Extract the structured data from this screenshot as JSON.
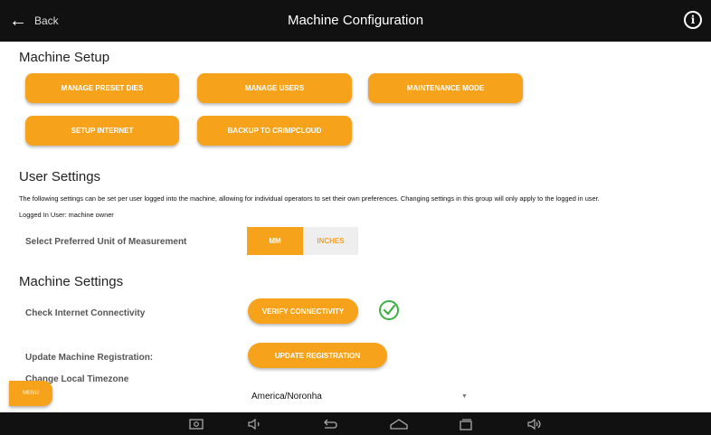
{
  "header": {
    "back_label": "Back",
    "title": "Machine Configuration"
  },
  "machine_setup": {
    "title": "Machine Setup",
    "buttons": [
      "MANAGE PRESET DIES",
      "MANAGE USERS",
      "MAINTENANCE MODE",
      "SETUP INTERNET",
      "BACKUP TO CRIMPCLOUD"
    ]
  },
  "user_settings": {
    "title": "User Settings",
    "description": "The following settings can be set per user logged into the machine, allowing for individual operators to set their own preferences. Changing settings in this group will only apply to the logged in user.",
    "logged_in": "Logged In User: machine owner",
    "unit_label": "Select Preferred Unit of Measurement",
    "unit_options": [
      "MM",
      "INCHES"
    ],
    "unit_selected": "MM"
  },
  "machine_settings": {
    "title": "Machine Settings",
    "connectivity_label": "Check Internet Connectivity",
    "verify_button": "VERIFY CONNECTIVITY",
    "registration_label": "Update Machine Registration:",
    "registration_button": "UPDATE REGISTRATION",
    "timezone_label": "Change Local Timezone",
    "timezone_value": "America/Noronha"
  },
  "menu_label": "MENU",
  "colors": {
    "accent": "#f7a21b",
    "success": "#3cb043",
    "topbar": "#111111"
  }
}
